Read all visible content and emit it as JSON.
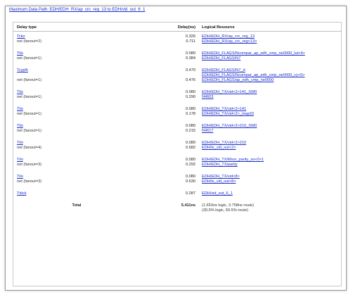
{
  "title": "Maximum Data Path: EDH/EDH_RX/ap_crc_reg_13 to EDH/vid_out_6_1",
  "headers": {
    "type": "Delay type",
    "delay": "Delay(ns)",
    "resource": "Logical Resource"
  },
  "rows": [
    {
      "type": "Tcko",
      "type_link": true,
      "delay": "0.326",
      "resource": [
        "EDH/EDH_RX/ap_crc_reg_13"
      ],
      "res_link": true
    },
    {
      "type": "net (fanout=2)",
      "type_link": false,
      "delay": "0.711",
      "resource": [
        "EDH/EDH_RX/ap_crc_reg<13>"
      ],
      "res_link": true
    },
    {
      "type": "Tilo",
      "type_link": true,
      "delay": "0.080",
      "resource": [
        "EDH/EDH_FLAGS/Ncompar_ap_edh_cmp_ne0000_lut<4>"
      ],
      "res_link": true
    },
    {
      "type": "net (fanout=1)",
      "type_link": false,
      "delay": "0.384",
      "resource": [
        "EDH/EDH_FLAGS/N7"
      ],
      "res_link": true
    },
    {
      "type": "Tcyplh",
      "type_link": true,
      "delay": "0.470",
      "resource": [
        "EDH/EDH_FLAGS/N7_rt",
        "EDH/EDH_FLAGS/Ncompar_ap_edh_cmp_ne0000_cy<5>"
      ],
      "res_link": true
    },
    {
      "type": "net (fanout=1)",
      "type_link": false,
      "delay": "0.476",
      "resource": [
        "EDH/EDH_FLAGS/ap_edh_cmp_ne0000"
      ],
      "res_link": true
    },
    {
      "type": "Tilo",
      "type_link": true,
      "delay": "0.080",
      "resource": [
        "EDH/EDH_TX/vid<2>141_SW0"
      ],
      "res_link": true
    },
    {
      "type": "net (fanout=1)",
      "type_link": false,
      "delay": "0.290",
      "resource": [
        "N4603"
      ],
      "res_link": true
    },
    {
      "type": "Tilo",
      "type_link": true,
      "delay": "0.080",
      "resource": [
        "EDH/EDH_TX/vid<2>141"
      ],
      "res_link": true
    },
    {
      "type": "net (fanout=1)",
      "type_link": false,
      "delay": "0.178",
      "resource": [
        "EDH/EDH_TX/vid<2>_map33"
      ],
      "res_link": true
    },
    {
      "type": "Tilo",
      "type_link": true,
      "delay": "0.080",
      "resource": [
        "EDH/EDH_TX/vid<2>210_SW0"
      ],
      "res_link": true
    },
    {
      "type": "net (fanout=1)",
      "type_link": false,
      "delay": "0.215",
      "resource": [
        "N4617"
      ],
      "res_link": true
    },
    {
      "type": "Tilo",
      "type_link": true,
      "delay": "0.080",
      "resource": [
        "EDH/EDH_TX/vid<2>210"
      ],
      "res_link": true
    },
    {
      "type": "net (fanout=4)",
      "type_link": false,
      "delay": "0.582",
      "resource": [
        "EDH/tx_vid_out<2>"
      ],
      "res_link": true
    },
    {
      "type": "Tilo",
      "type_link": true,
      "delay": "0.080",
      "resource": [
        "EDH/EDH_TX/Mxor_parity_xo<0>1"
      ],
      "res_link": true
    },
    {
      "type": "net (fanout=3)",
      "type_link": false,
      "delay": "0.292",
      "resource": [
        "EDH/EDH_TX/parity"
      ],
      "res_link": true
    },
    {
      "type": "Tilo",
      "type_link": true,
      "delay": "0.080",
      "resource": [
        "EDH/EDH_TX/vid<8>"
      ],
      "res_link": true
    },
    {
      "type": "net (fanout=3)",
      "type_link": false,
      "delay": "0.630",
      "resource": [
        "EDH/tx_vid_out<8>"
      ],
      "res_link": true
    },
    {
      "type": "Tdick",
      "type_link": true,
      "delay": "0.287",
      "resource": [
        "EDH/vid_out_6_1"
      ],
      "res_link": true
    }
  ],
  "total": {
    "label": "Total",
    "delay": "5.411ns",
    "resource": [
      "(1.653ns logic, 3.758ns route)",
      "(30.5% logic, 69.5% route)"
    ]
  }
}
